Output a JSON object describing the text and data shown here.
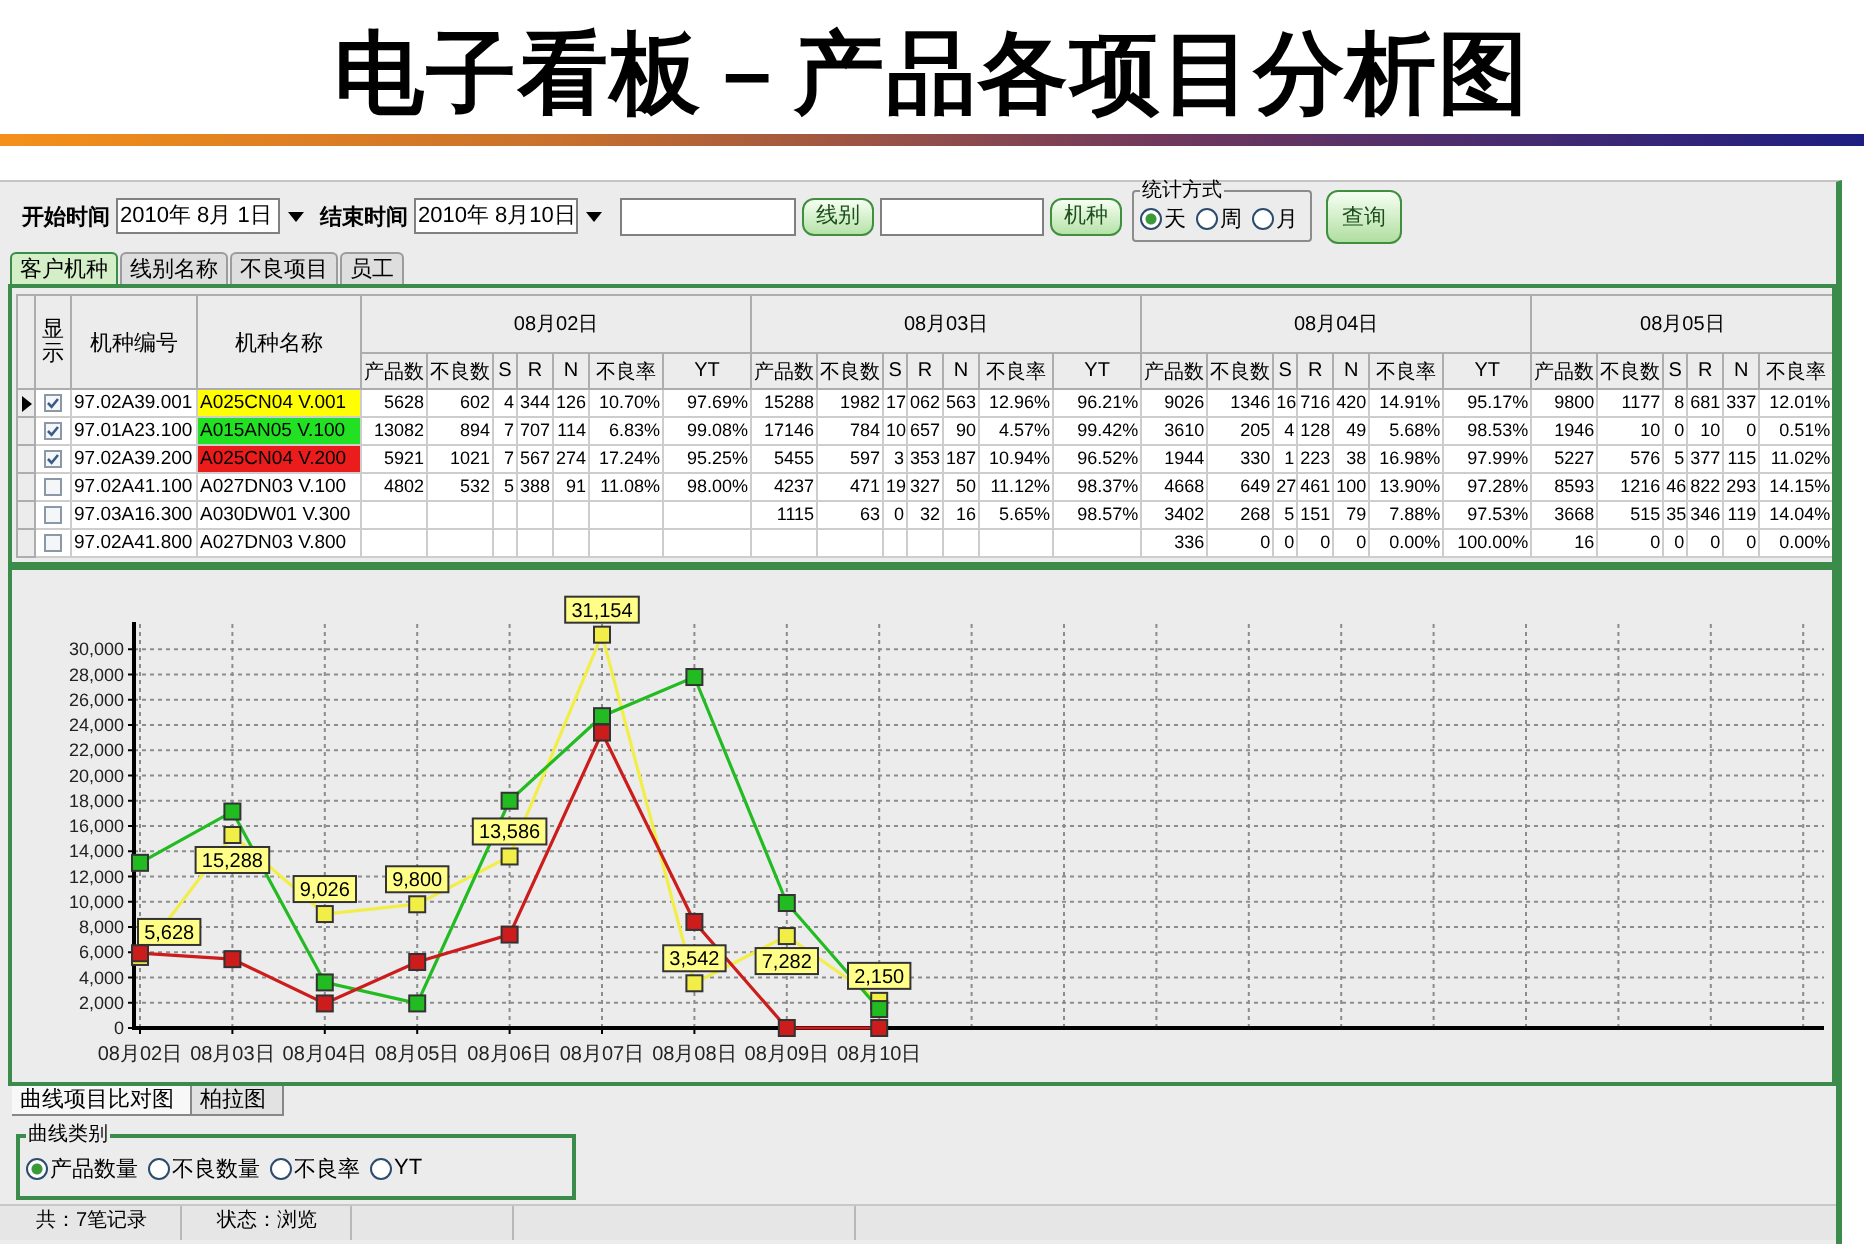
{
  "title": "电子看板－产品各项目分析图",
  "toolbar": {
    "start": {
      "label": "开始时间",
      "value": "2010年 8月 1日"
    },
    "end": {
      "label": "结束时间",
      "value": "2010年 8月10日"
    },
    "filters": [
      {
        "button": "线别"
      },
      {
        "button": "机种"
      }
    ],
    "mode": {
      "legend": "统计方式",
      "options": [
        {
          "label": "天",
          "selected": true
        },
        {
          "label": "周",
          "selected": false
        },
        {
          "label": "月",
          "selected": false
        }
      ]
    },
    "query_button": "查询"
  },
  "tabs": [
    {
      "label": "客户机种",
      "selected": true
    },
    {
      "label": "线别名称",
      "selected": false
    },
    {
      "label": "不良项目",
      "selected": false
    },
    {
      "label": "员工",
      "selected": false
    }
  ],
  "table": {
    "headers": {
      "show": "显示",
      "code": "机种编号",
      "name": "机种名称"
    },
    "days": [
      {
        "date": "08月02日",
        "columns": [
          "产品数",
          "不良数",
          "S",
          "R",
          "N",
          "不良率",
          "YT"
        ]
      },
      {
        "date": "08月03日",
        "columns": [
          "产品数",
          "不良数",
          "S",
          "R",
          "N",
          "不良率",
          "YT"
        ]
      },
      {
        "date": "08月04日",
        "columns": [
          "产品数",
          "不良数",
          "S",
          "R",
          "N",
          "不良率",
          "YT"
        ]
      },
      {
        "date": "08月05日",
        "columns": [
          "产品数",
          "不良数",
          "S",
          "R",
          "N",
          "不良率"
        ]
      }
    ],
    "rows": [
      {
        "selected": true,
        "checked": true,
        "code": "97.02A39.001",
        "name": "A025CN04 V.001",
        "color": "#ffff00",
        "days": [
          [
            "5628",
            "602",
            "4",
            "344",
            "126",
            "10.70%",
            "97.69%"
          ],
          [
            "15288",
            "1982",
            "17",
            "062",
            "563",
            "12.96%",
            "96.21%"
          ],
          [
            "9026",
            "1346",
            "16",
            "716",
            "420",
            "14.91%",
            "95.17%"
          ],
          [
            "9800",
            "1177",
            "8",
            "681",
            "337",
            "12.01%"
          ]
        ]
      },
      {
        "selected": false,
        "checked": true,
        "code": "97.01A23.100",
        "name": "A015AN05 V.100",
        "color": "#22e022",
        "days": [
          [
            "13082",
            "894",
            "7",
            "707",
            "114",
            "6.83%",
            "99.08%"
          ],
          [
            "17146",
            "784",
            "10",
            "657",
            "90",
            "4.57%",
            "99.42%"
          ],
          [
            "3610",
            "205",
            "4",
            "128",
            "49",
            "5.68%",
            "98.53%"
          ],
          [
            "1946",
            "10",
            "0",
            "10",
            "0",
            "0.51%"
          ]
        ]
      },
      {
        "selected": false,
        "checked": true,
        "code": "97.02A39.200",
        "name": "A025CN04 V.200",
        "color": "#ea1c1c",
        "days": [
          [
            "5921",
            "1021",
            "7",
            "567",
            "274",
            "17.24%",
            "95.25%"
          ],
          [
            "5455",
            "597",
            "3",
            "353",
            "187",
            "10.94%",
            "96.52%"
          ],
          [
            "1944",
            "330",
            "1",
            "223",
            "38",
            "16.98%",
            "97.99%"
          ],
          [
            "5227",
            "576",
            "5",
            "377",
            "115",
            "11.02%"
          ]
        ]
      },
      {
        "selected": false,
        "checked": false,
        "code": "97.02A41.100",
        "name": "A027DN03 V.100",
        "days": [
          [
            "4802",
            "532",
            "5",
            "388",
            "91",
            "11.08%",
            "98.00%"
          ],
          [
            "4237",
            "471",
            "19",
            "327",
            "50",
            "11.12%",
            "98.37%"
          ],
          [
            "4668",
            "649",
            "27",
            "461",
            "100",
            "13.90%",
            "97.28%"
          ],
          [
            "8593",
            "1216",
            "46",
            "822",
            "293",
            "14.15%"
          ]
        ]
      },
      {
        "selected": false,
        "checked": false,
        "code": "97.03A16.300",
        "name": "A030DW01 V.300",
        "days": [
          [
            "1115",
            "63",
            "0",
            "32",
            "16",
            "5.65%",
            "98.57%"
          ],
          [
            "3402",
            "268",
            "5",
            "151",
            "79",
            "7.88%",
            "97.53%"
          ],
          [
            "3668",
            "515",
            "35",
            "346",
            "119",
            "14.04%"
          ]
        ]
      },
      {
        "selected": false,
        "checked": false,
        "code": "97.02A41.800",
        "name": "A027DN03 V.800",
        "days": [
          [
            "336",
            "0",
            "0",
            "0",
            "0",
            "0.00%",
            "100.00%"
          ],
          [
            "16",
            "0",
            "0",
            "0",
            "0",
            "0.00%"
          ]
        ]
      }
    ]
  },
  "chart": {
    "chart_data": {
      "type": "line",
      "grid": true,
      "categories": [
        "08月02日",
        "08月03日",
        "08月04日",
        "08月05日",
        "08月06日",
        "08月07日",
        "08月08日",
        "08月09日",
        "08月10日"
      ],
      "ylim": [
        0,
        32000
      ],
      "yticks": [
        {
          "value": 0,
          "label": "0"
        },
        {
          "value": 2000,
          "label": "2,000"
        },
        {
          "value": 4000,
          "label": "4,000"
        },
        {
          "value": 6000,
          "label": "6,000"
        },
        {
          "value": 8000,
          "label": "8,000"
        },
        {
          "value": 10000,
          "label": "10,000"
        },
        {
          "value": 12000,
          "label": "12,000"
        },
        {
          "value": 14000,
          "label": "14,000"
        },
        {
          "value": 16000,
          "label": "16,000"
        },
        {
          "value": 18000,
          "label": "18,000"
        },
        {
          "value": 20000,
          "label": "20,000"
        },
        {
          "value": 22000,
          "label": "22,000"
        },
        {
          "value": 24000,
          "label": "24,000"
        },
        {
          "value": 26000,
          "label": "26,000"
        },
        {
          "value": 28000,
          "label": "28,000"
        },
        {
          "value": 30000,
          "label": "30,000"
        }
      ],
      "series": [
        {
          "color": "#f2ee48",
          "marker": "square",
          "values": [
            5628,
            15288,
            9026,
            9800,
            13586,
            31154,
            3542,
            7282,
            2150
          ],
          "value_labels": [
            "5,628",
            "15,288",
            "9,026",
            "9,800",
            "13,586",
            "31,154",
            "3,542",
            "7,282",
            "2,150"
          ]
        },
        {
          "color": "#22bb22",
          "marker": "square",
          "values": [
            13082,
            17146,
            3610,
            1946,
            18000,
            24700,
            27800,
            9900,
            1500
          ]
        },
        {
          "color": "#cc1c1c",
          "marker": "square",
          "values": [
            5921,
            5455,
            1944,
            5227,
            7400,
            23400,
            8400,
            0,
            0
          ]
        }
      ]
    }
  },
  "chart_tabs": [
    {
      "label": "曲线项目比对图",
      "selected": true
    },
    {
      "label": "柏拉图",
      "selected": false
    }
  ],
  "curve_type": {
    "legend": "曲线类别",
    "options": [
      {
        "label": "产品数量",
        "selected": true
      },
      {
        "label": "不良数量",
        "selected": false
      },
      {
        "label": "不良率",
        "selected": false
      },
      {
        "label": "YT",
        "selected": false
      }
    ]
  },
  "status_bar": [
    {
      "text": "共：7笔记录"
    },
    {
      "text": "状态：浏览"
    }
  ]
}
